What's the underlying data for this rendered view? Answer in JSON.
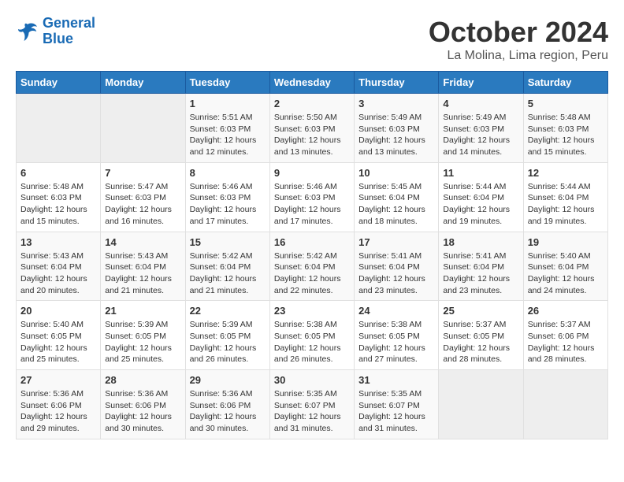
{
  "header": {
    "logo_line1": "General",
    "logo_line2": "Blue",
    "month": "October 2024",
    "location": "La Molina, Lima region, Peru"
  },
  "weekdays": [
    "Sunday",
    "Monday",
    "Tuesday",
    "Wednesday",
    "Thursday",
    "Friday",
    "Saturday"
  ],
  "weeks": [
    [
      {
        "day": "",
        "info": ""
      },
      {
        "day": "",
        "info": ""
      },
      {
        "day": "1",
        "info": "Sunrise: 5:51 AM\nSunset: 6:03 PM\nDaylight: 12 hours\nand 12 minutes."
      },
      {
        "day": "2",
        "info": "Sunrise: 5:50 AM\nSunset: 6:03 PM\nDaylight: 12 hours\nand 13 minutes."
      },
      {
        "day": "3",
        "info": "Sunrise: 5:49 AM\nSunset: 6:03 PM\nDaylight: 12 hours\nand 13 minutes."
      },
      {
        "day": "4",
        "info": "Sunrise: 5:49 AM\nSunset: 6:03 PM\nDaylight: 12 hours\nand 14 minutes."
      },
      {
        "day": "5",
        "info": "Sunrise: 5:48 AM\nSunset: 6:03 PM\nDaylight: 12 hours\nand 15 minutes."
      }
    ],
    [
      {
        "day": "6",
        "info": "Sunrise: 5:48 AM\nSunset: 6:03 PM\nDaylight: 12 hours\nand 15 minutes."
      },
      {
        "day": "7",
        "info": "Sunrise: 5:47 AM\nSunset: 6:03 PM\nDaylight: 12 hours\nand 16 minutes."
      },
      {
        "day": "8",
        "info": "Sunrise: 5:46 AM\nSunset: 6:03 PM\nDaylight: 12 hours\nand 17 minutes."
      },
      {
        "day": "9",
        "info": "Sunrise: 5:46 AM\nSunset: 6:03 PM\nDaylight: 12 hours\nand 17 minutes."
      },
      {
        "day": "10",
        "info": "Sunrise: 5:45 AM\nSunset: 6:04 PM\nDaylight: 12 hours\nand 18 minutes."
      },
      {
        "day": "11",
        "info": "Sunrise: 5:44 AM\nSunset: 6:04 PM\nDaylight: 12 hours\nand 19 minutes."
      },
      {
        "day": "12",
        "info": "Sunrise: 5:44 AM\nSunset: 6:04 PM\nDaylight: 12 hours\nand 19 minutes."
      }
    ],
    [
      {
        "day": "13",
        "info": "Sunrise: 5:43 AM\nSunset: 6:04 PM\nDaylight: 12 hours\nand 20 minutes."
      },
      {
        "day": "14",
        "info": "Sunrise: 5:43 AM\nSunset: 6:04 PM\nDaylight: 12 hours\nand 21 minutes."
      },
      {
        "day": "15",
        "info": "Sunrise: 5:42 AM\nSunset: 6:04 PM\nDaylight: 12 hours\nand 21 minutes."
      },
      {
        "day": "16",
        "info": "Sunrise: 5:42 AM\nSunset: 6:04 PM\nDaylight: 12 hours\nand 22 minutes."
      },
      {
        "day": "17",
        "info": "Sunrise: 5:41 AM\nSunset: 6:04 PM\nDaylight: 12 hours\nand 23 minutes."
      },
      {
        "day": "18",
        "info": "Sunrise: 5:41 AM\nSunset: 6:04 PM\nDaylight: 12 hours\nand 23 minutes."
      },
      {
        "day": "19",
        "info": "Sunrise: 5:40 AM\nSunset: 6:04 PM\nDaylight: 12 hours\nand 24 minutes."
      }
    ],
    [
      {
        "day": "20",
        "info": "Sunrise: 5:40 AM\nSunset: 6:05 PM\nDaylight: 12 hours\nand 25 minutes."
      },
      {
        "day": "21",
        "info": "Sunrise: 5:39 AM\nSunset: 6:05 PM\nDaylight: 12 hours\nand 25 minutes."
      },
      {
        "day": "22",
        "info": "Sunrise: 5:39 AM\nSunset: 6:05 PM\nDaylight: 12 hours\nand 26 minutes."
      },
      {
        "day": "23",
        "info": "Sunrise: 5:38 AM\nSunset: 6:05 PM\nDaylight: 12 hours\nand 26 minutes."
      },
      {
        "day": "24",
        "info": "Sunrise: 5:38 AM\nSunset: 6:05 PM\nDaylight: 12 hours\nand 27 minutes."
      },
      {
        "day": "25",
        "info": "Sunrise: 5:37 AM\nSunset: 6:05 PM\nDaylight: 12 hours\nand 28 minutes."
      },
      {
        "day": "26",
        "info": "Sunrise: 5:37 AM\nSunset: 6:06 PM\nDaylight: 12 hours\nand 28 minutes."
      }
    ],
    [
      {
        "day": "27",
        "info": "Sunrise: 5:36 AM\nSunset: 6:06 PM\nDaylight: 12 hours\nand 29 minutes."
      },
      {
        "day": "28",
        "info": "Sunrise: 5:36 AM\nSunset: 6:06 PM\nDaylight: 12 hours\nand 30 minutes."
      },
      {
        "day": "29",
        "info": "Sunrise: 5:36 AM\nSunset: 6:06 PM\nDaylight: 12 hours\nand 30 minutes."
      },
      {
        "day": "30",
        "info": "Sunrise: 5:35 AM\nSunset: 6:07 PM\nDaylight: 12 hours\nand 31 minutes."
      },
      {
        "day": "31",
        "info": "Sunrise: 5:35 AM\nSunset: 6:07 PM\nDaylight: 12 hours\nand 31 minutes."
      },
      {
        "day": "",
        "info": ""
      },
      {
        "day": "",
        "info": ""
      }
    ]
  ]
}
